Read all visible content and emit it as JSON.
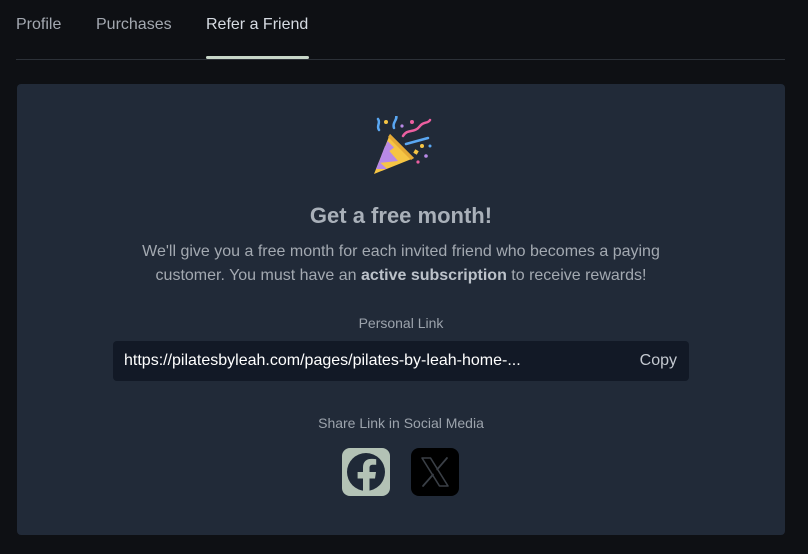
{
  "tabs": [
    {
      "label": "Profile"
    },
    {
      "label": "Purchases"
    },
    {
      "label": "Refer a Friend",
      "active": true
    }
  ],
  "referral": {
    "icon": "party-popper-icon",
    "title": "Get a free month!",
    "description_part1": "We'll give you a free month for each invited friend who becomes a paying customer. You must have an ",
    "description_bold": "active subscription",
    "description_part2": " to receive rewards!",
    "personal_link_label": "Personal Link",
    "personal_link_value": "https://pilatesbyleah.com/pages/pilates-by-leah-home-...",
    "copy_label": "Copy",
    "share_label": "Share Link in Social Media",
    "social": [
      {
        "icon": "facebook-icon",
        "color": "#b3c2b5"
      },
      {
        "icon": "x-twitter-icon",
        "color": "#000000"
      }
    ]
  },
  "colors": {
    "background": "#0e1014",
    "card": "#212a38",
    "link_box": "#121926",
    "tab_underline": "#c7d6c8"
  }
}
